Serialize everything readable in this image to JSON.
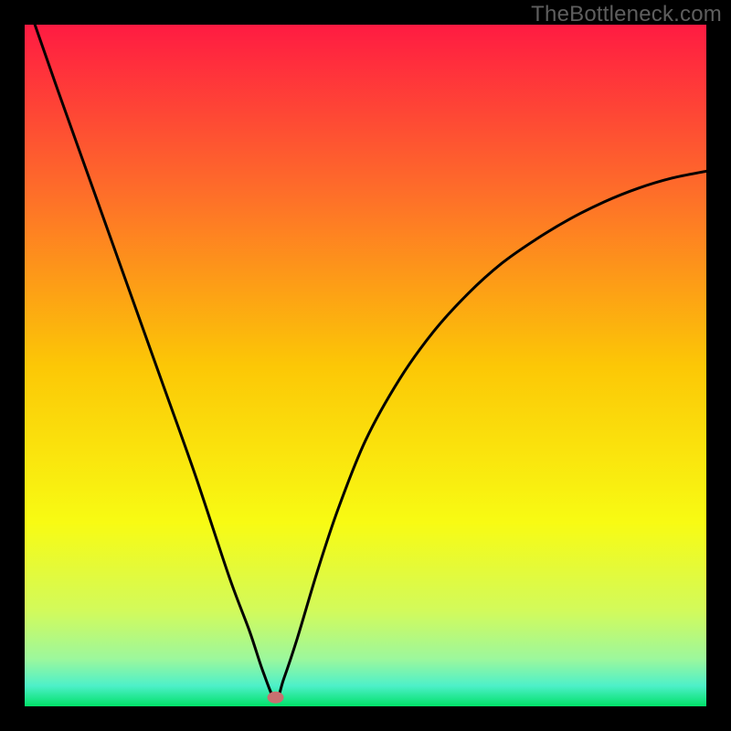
{
  "watermark": "TheBottleneck.com",
  "chart_data": {
    "type": "line",
    "title": "",
    "xlabel": "",
    "ylabel": "",
    "xlim": [
      0,
      100
    ],
    "ylim": [
      0,
      100
    ],
    "grid": false,
    "background_gradient": {
      "stops": [
        {
          "offset": 0,
          "color": "#ff1b42"
        },
        {
          "offset": 25,
          "color": "#fe6f29"
        },
        {
          "offset": 50,
          "color": "#fcc706"
        },
        {
          "offset": 73,
          "color": "#f8fb13"
        },
        {
          "offset": 86,
          "color": "#d2fa5b"
        },
        {
          "offset": 93,
          "color": "#9df89c"
        },
        {
          "offset": 97,
          "color": "#4df0c9"
        },
        {
          "offset": 100,
          "color": "#01e169"
        }
      ]
    },
    "minimum_marker": {
      "x": 36.8,
      "y": 1.3,
      "color": "#c77070"
    },
    "series": [
      {
        "name": "bottleneck-curve",
        "x": [
          1.5,
          5,
          10,
          15,
          20,
          25,
          30,
          33,
          35,
          36.8,
          38,
          40,
          43,
          46,
          50,
          55,
          60,
          65,
          70,
          75,
          80,
          85,
          90,
          95,
          100
        ],
        "y": [
          100,
          90,
          76,
          62,
          48,
          34,
          19,
          11,
          5,
          1,
          4,
          10,
          20,
          29,
          39,
          48,
          55,
          60.5,
          65,
          68.5,
          71.5,
          74,
          76,
          77.5,
          78.5
        ]
      }
    ]
  }
}
